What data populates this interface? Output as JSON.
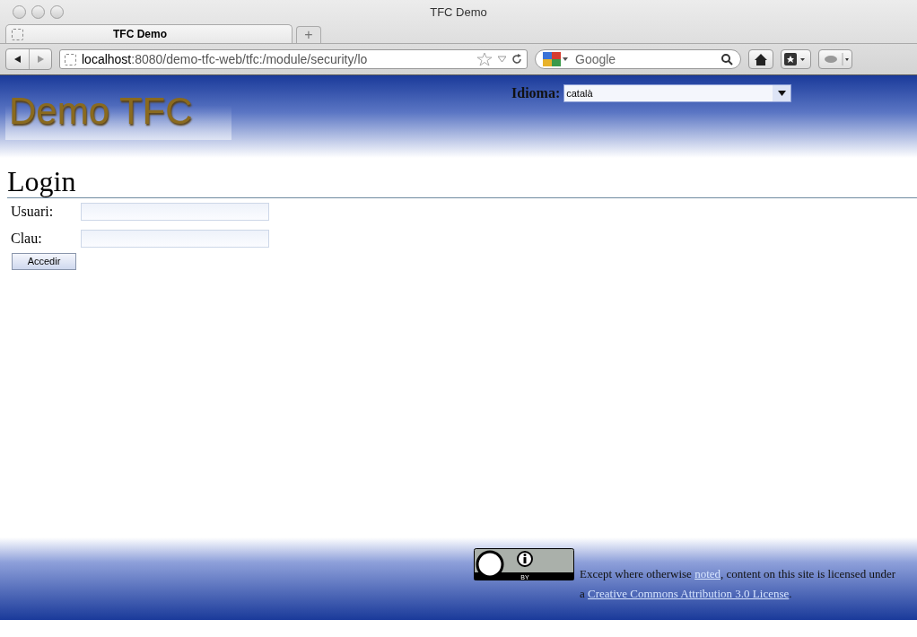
{
  "window": {
    "title": "TFC Demo"
  },
  "tabs": [
    {
      "label": "TFC Demo",
      "selected": true
    }
  ],
  "new_tab": {
    "label": "+"
  },
  "toolbar": {
    "url_host": "localhost",
    "url_rest": ":8080/demo-tfc-web/tfc:/module/security/lo",
    "search_placeholder": "Google"
  },
  "header": {
    "logo": "Demo TFC",
    "language_label": "Idioma:",
    "language_value": "català"
  },
  "login": {
    "title": "Login",
    "fields": [
      {
        "label": "Usuari:"
      },
      {
        "label": "Clau:"
      }
    ],
    "submit": "Accedir"
  },
  "footer": {
    "badge_text": "BY",
    "text_before": "Except where otherwise ",
    "link1": "noted",
    "text_middle": ", content on this site is licensed under a ",
    "link2": "Creative Commons Attribution 3.0 License",
    "text_after": "."
  }
}
